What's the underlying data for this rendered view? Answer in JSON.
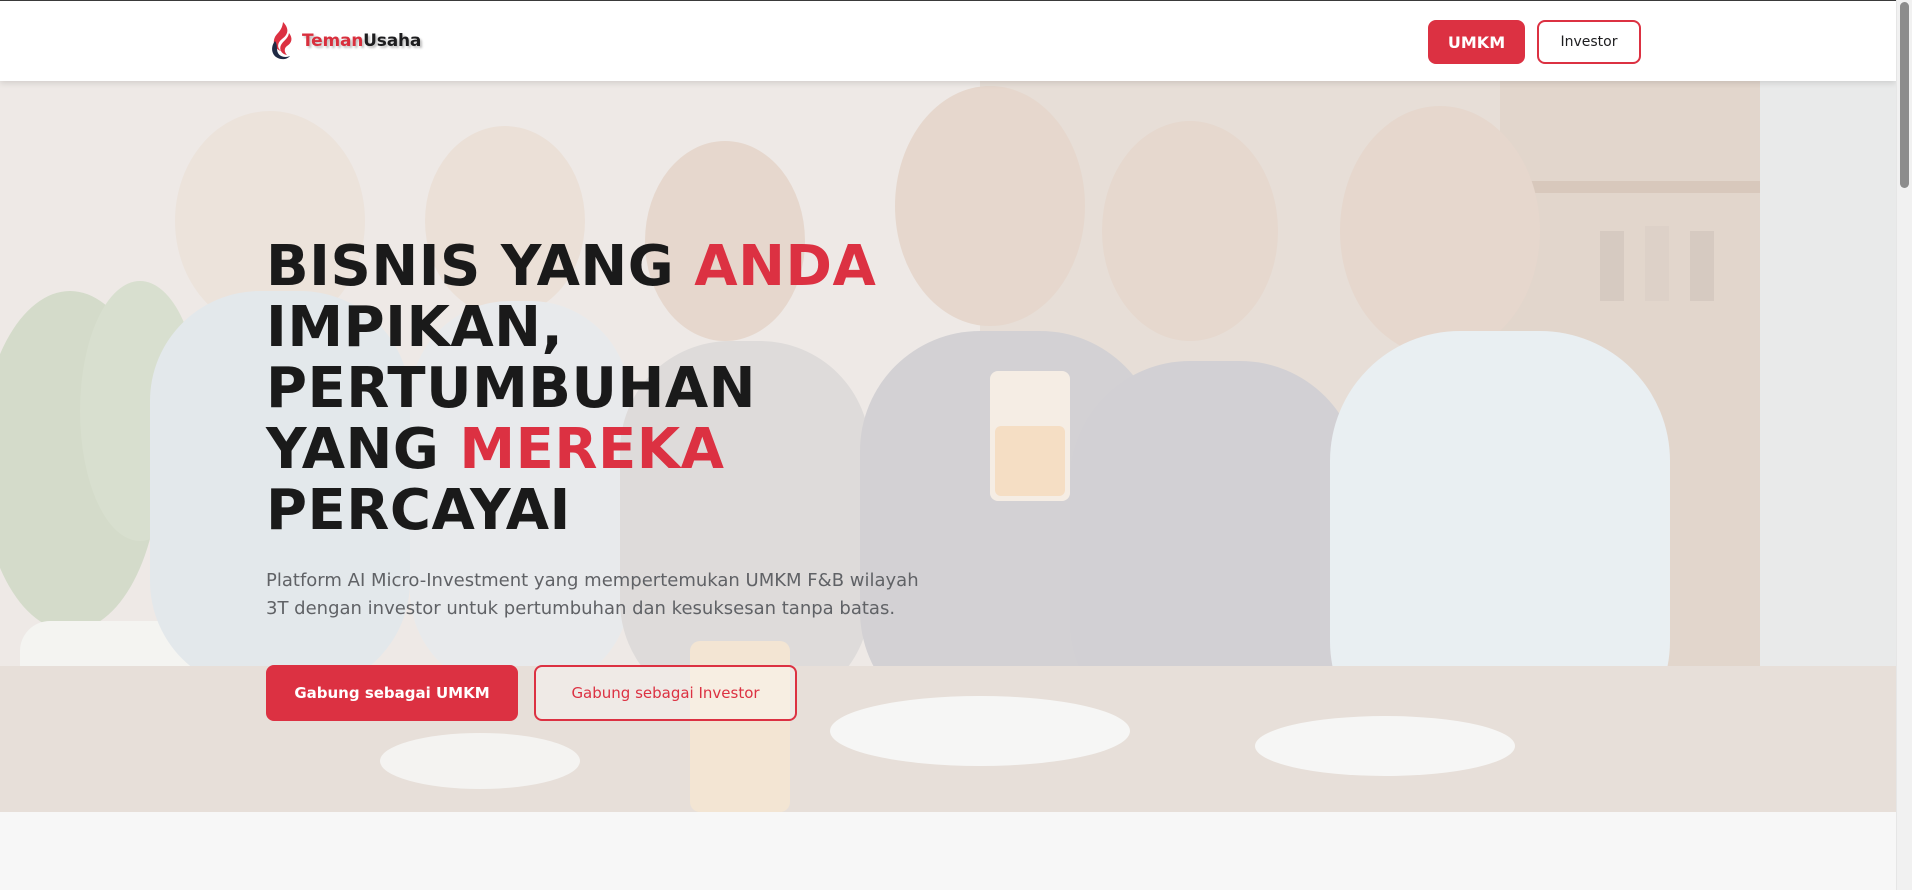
{
  "brand": {
    "name_part1": "Teman",
    "name_part2": "Usaha"
  },
  "nav": {
    "umkm_label": "UMKM",
    "investor_label": "Investor"
  },
  "hero": {
    "title": {
      "w1": "BISNIS YANG ",
      "a1": "ANDA",
      "w2": "IMPIKAN,",
      "w3": "PERTUMBUHAN",
      "w4": "YANG ",
      "a2": "MEREKA",
      "w5": "PERCAYAI"
    },
    "subtitle": "Platform AI Micro-Investment yang mempertemukan UMKM F&B wilayah 3T dengan investor untuk pertumbuhan dan kesuksesan tanpa batas.",
    "cta_umkm": "Gabung sebagai UMKM",
    "cta_investor": "Gabung sebagai Investor"
  },
  "colors": {
    "accent": "#dc3142",
    "text_dark": "#1a1a1a",
    "text_muted": "#606266",
    "page_bg": "#f7f7f7"
  },
  "icons": {
    "logo": "temanusaha-flame-logo-icon"
  }
}
